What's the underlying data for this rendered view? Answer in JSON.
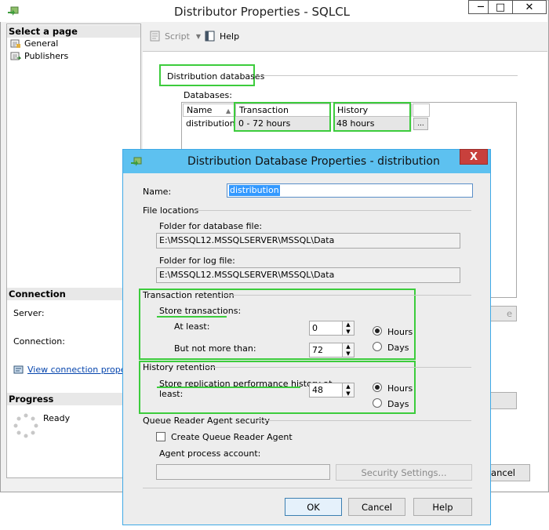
{
  "outer_window": {
    "title": "Distributor Properties - SQLCL",
    "minimize": "—",
    "maximize": "□",
    "close": "✕"
  },
  "left_pane": {
    "select_page_header": "Select a page",
    "pages": [
      "General",
      "Publishers"
    ],
    "connection_header": "Connection",
    "server_label": "Server:",
    "connection_label": "Connection:",
    "view_connection_link": "View connection properti",
    "progress_header": "Progress",
    "progress_status": "Ready"
  },
  "toolbar": {
    "script_label": "Script",
    "help_label": "Help"
  },
  "main": {
    "distribution_databases_heading": "Distribution databases",
    "databases_label": "Databases:",
    "columns": [
      "Name",
      "Transaction Retention",
      "History Retention"
    ],
    "rows": [
      {
        "name": "distribution",
        "transaction_retention": "0 - 72 hours",
        "history_retention": "48 hours"
      }
    ],
    "ellipsis_button": "...",
    "partial_button_right": "e",
    "cancel_partial": "Cancel"
  },
  "dialog": {
    "title": "Distribution Database Properties - distribution",
    "close": "X",
    "name_label": "Name:",
    "name_value": "distribution",
    "file_locations_heading": "File locations",
    "db_folder_label": "Folder for database file:",
    "db_folder_value": "E:\\MSSQL12.MSSQLSERVER\\MSSQL\\Data",
    "log_folder_label": "Folder for log file:",
    "log_folder_value": "E:\\MSSQL12.MSSQLSERVER\\MSSQL\\Data",
    "transaction_retention_heading": "Transaction retention",
    "store_transactions_label": "Store transactions:",
    "at_least_label": "At least:",
    "at_least_value": "0",
    "not_more_than_label": "But not more than:",
    "not_more_than_value": "72",
    "hours_label": "Hours",
    "days_label": "Days",
    "history_retention_heading": "History retention",
    "store_history_label_line1": "Store replication performance history at",
    "store_history_label_line2": "least:",
    "history_value": "48",
    "history_hours_label": "Hours",
    "history_days_label": "Days",
    "queue_reader_heading": "Queue Reader Agent security",
    "create_queue_reader_label": "Create Queue Reader Agent",
    "agent_process_label": "Agent process account:",
    "security_settings_button": "Security Settings...",
    "ok_button": "OK",
    "cancel_button": "Cancel",
    "help_button": "Help"
  },
  "colors": {
    "highlight_green": "#3ccc3c",
    "dialog_titlebar": "#5dc1f0",
    "close_red": "#c8403c",
    "link_blue": "#0645ad"
  }
}
